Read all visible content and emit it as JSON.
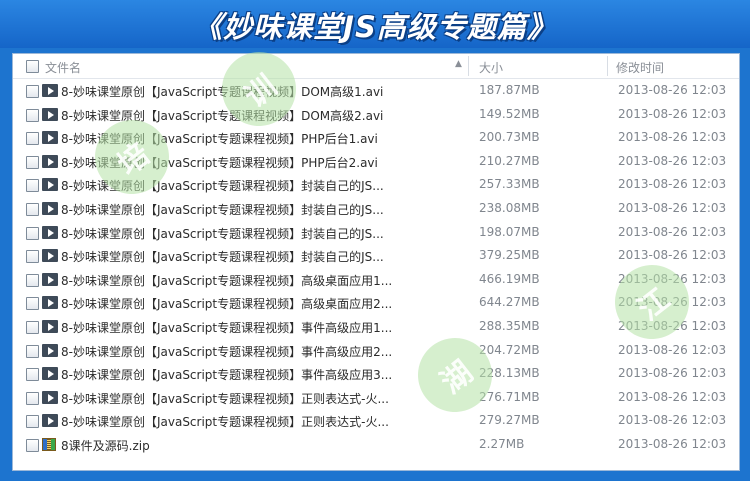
{
  "banner": {
    "title": "《妙味课堂JS高级专题篇》"
  },
  "header": {
    "col_name": "文件名",
    "col_size": "大小",
    "col_date": "修改时间"
  },
  "files": [
    {
      "name": "8-妙味课堂原创【JavaScript专题课程视频】DOM高级1.avi",
      "size": "187.87MB",
      "date": "2013-08-26 12:03",
      "icon": "video-icon"
    },
    {
      "name": "8-妙味课堂原创【JavaScript专题课程视频】DOM高级2.avi",
      "size": "149.52MB",
      "date": "2013-08-26 12:03",
      "icon": "video-icon"
    },
    {
      "name": "8-妙味课堂原创【JavaScript专题课程视频】PHP后台1.avi",
      "size": "200.73MB",
      "date": "2013-08-26 12:03",
      "icon": "video-icon"
    },
    {
      "name": "8-妙味课堂原创【JavaScript专题课程视频】PHP后台2.avi",
      "size": "210.27MB",
      "date": "2013-08-26 12:03",
      "icon": "video-icon"
    },
    {
      "name": "8-妙味课堂原创【JavaScript专题课程视频】封装自己的JS...",
      "size": "257.33MB",
      "date": "2013-08-26 12:03",
      "icon": "video-icon"
    },
    {
      "name": "8-妙味课堂原创【JavaScript专题课程视频】封装自己的JS...",
      "size": "238.08MB",
      "date": "2013-08-26 12:03",
      "icon": "video-icon"
    },
    {
      "name": "8-妙味课堂原创【JavaScript专题课程视频】封装自己的JS...",
      "size": "198.07MB",
      "date": "2013-08-26 12:03",
      "icon": "video-icon"
    },
    {
      "name": "8-妙味课堂原创【JavaScript专题课程视频】封装自己的JS...",
      "size": "379.25MB",
      "date": "2013-08-26 12:03",
      "icon": "video-icon"
    },
    {
      "name": "8-妙味课堂原创【JavaScript专题课程视频】高级桌面应用1...",
      "size": "466.19MB",
      "date": "2013-08-26 12:03",
      "icon": "video-icon"
    },
    {
      "name": "8-妙味课堂原创【JavaScript专题课程视频】高级桌面应用2...",
      "size": "644.27MB",
      "date": "2013-08-26 12:03",
      "icon": "video-icon"
    },
    {
      "name": "8-妙味课堂原创【JavaScript专题课程视频】事件高级应用1...",
      "size": "288.35MB",
      "date": "2013-08-26 12:03",
      "icon": "video-icon"
    },
    {
      "name": "8-妙味课堂原创【JavaScript专题课程视频】事件高级应用2...",
      "size": "204.72MB",
      "date": "2013-08-26 12:03",
      "icon": "video-icon"
    },
    {
      "name": "8-妙味课堂原创【JavaScript专题课程视频】事件高级应用3...",
      "size": "228.13MB",
      "date": "2013-08-26 12:03",
      "icon": "video-icon"
    },
    {
      "name": "8-妙味课堂原创【JavaScript专题课程视频】正则表达式-火...",
      "size": "276.71MB",
      "date": "2013-08-26 12:03",
      "icon": "video-icon"
    },
    {
      "name": "8-妙味课堂原创【JavaScript专题课程视频】正则表达式-火...",
      "size": "279.27MB",
      "date": "2013-08-26 12:03",
      "icon": "video-icon"
    },
    {
      "name": "8课件及源码.zip",
      "size": "2.27MB",
      "date": "2013-08-26 12:03",
      "icon": "zip-archive-icon"
    }
  ],
  "watermark": {
    "chars": [
      "培",
      "训",
      "江",
      "湖"
    ],
    "color": "#b4e1a5"
  },
  "colors": {
    "banner_bg": "#1d74cf",
    "panel_bg": "#ffffff",
    "text": "#2b2b2b",
    "muted": "#80868e"
  }
}
